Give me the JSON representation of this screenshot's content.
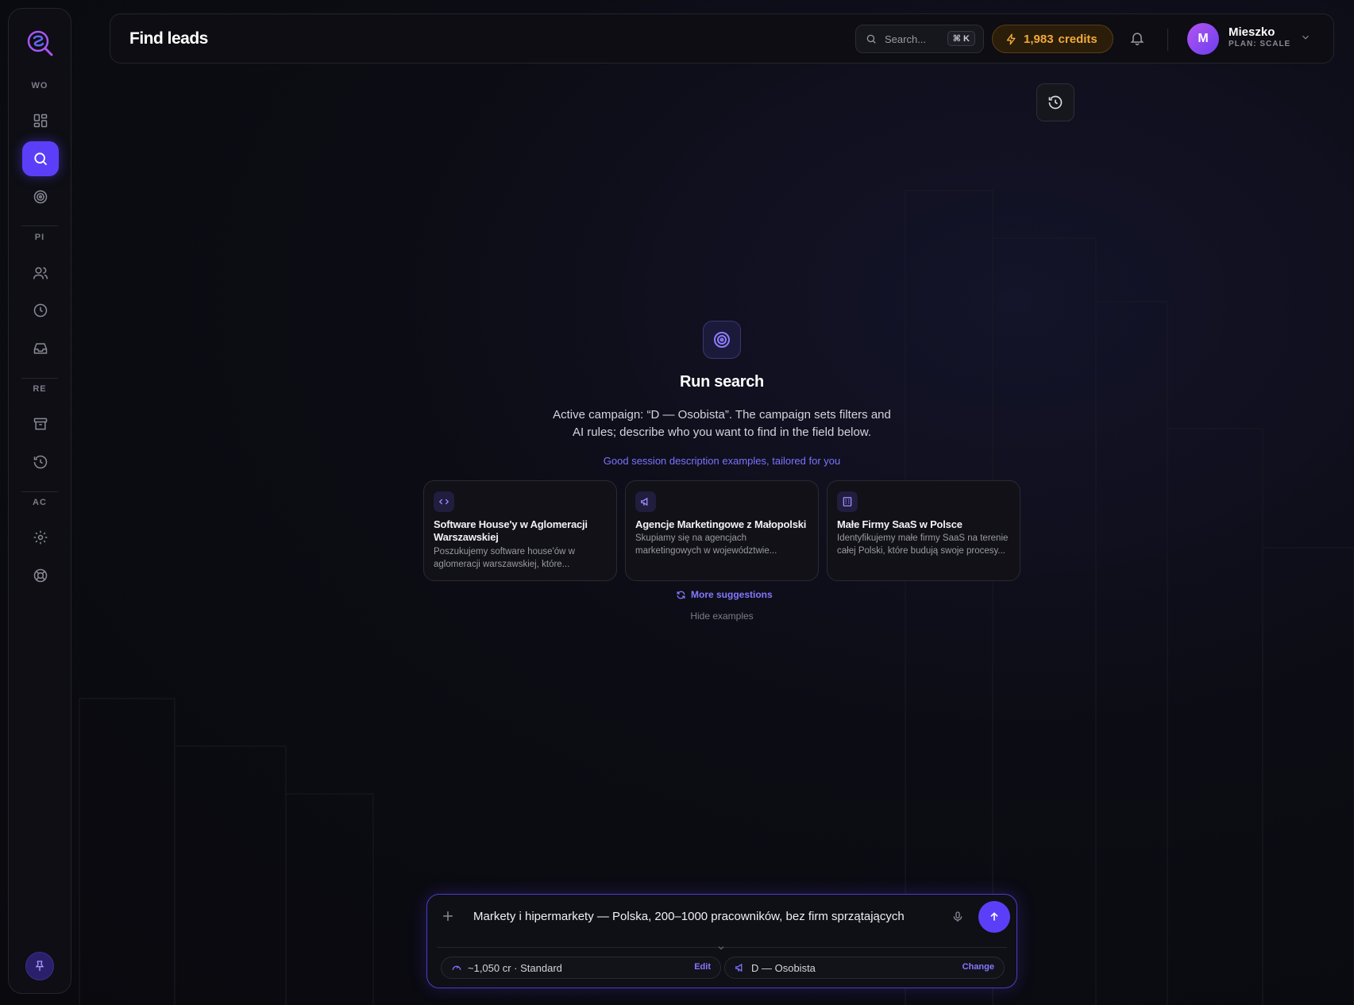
{
  "sidebar": {
    "sections": [
      "WO",
      "PI",
      "RE",
      "AC"
    ],
    "items": [
      {
        "icon": "dashboard-icon"
      },
      {
        "icon": "search-icon",
        "active": true
      },
      {
        "icon": "target-icon"
      },
      {
        "icon": "users-icon"
      },
      {
        "icon": "clock-icon"
      },
      {
        "icon": "inbox-icon"
      },
      {
        "icon": "archive-icon"
      },
      {
        "icon": "history-icon"
      },
      {
        "icon": "gear-icon"
      },
      {
        "icon": "lifebuoy-icon"
      }
    ],
    "bottom_icon": "pin-icon"
  },
  "header": {
    "title": "Find leads",
    "search_placeholder": "Search...",
    "search_shortcut": "⌘ K",
    "credits_value": "1,983",
    "credits_label": "credits",
    "user_initial": "M",
    "user_name": "Mieszko",
    "user_plan": "PLAN: SCALE"
  },
  "main": {
    "title": "Run search",
    "description": "Active campaign: “D — Osobista”. The campaign sets filters and AI rules; describe who you want to find in the field below.",
    "examples_label": "Good session description examples, tailored for you",
    "cards": [
      {
        "icon": "code-icon",
        "title": "Software House'y w Aglomeracji Warszawskiej",
        "desc": "Poszukujemy software house'ów w aglomeracji warszawskiej, które..."
      },
      {
        "icon": "megaphone-icon",
        "title": "Agencje Marketingowe z Małopolski",
        "desc": "Skupiamy się na agencjach marketingowych w województwie..."
      },
      {
        "icon": "building-icon",
        "title": "Małe Firmy SaaS w Polsce",
        "desc": "Identyfikujemy małe firmy SaaS na terenie całej Polski, które budują swoje procesy..."
      }
    ],
    "more_suggestions": "More suggestions",
    "hide_examples": "Hide examples"
  },
  "composer": {
    "input_value": "Markety i hipermarkety — Polska, 200–1000 pracowników, bez firm sprzątających",
    "cost": "~1,050 cr · Standard",
    "cost_action": "Edit",
    "campaign": "D — Osobista",
    "campaign_action": "Change"
  },
  "colors": {
    "accent": "#5b3ff8",
    "credits": "#f3a93a",
    "link": "#8478ff"
  }
}
